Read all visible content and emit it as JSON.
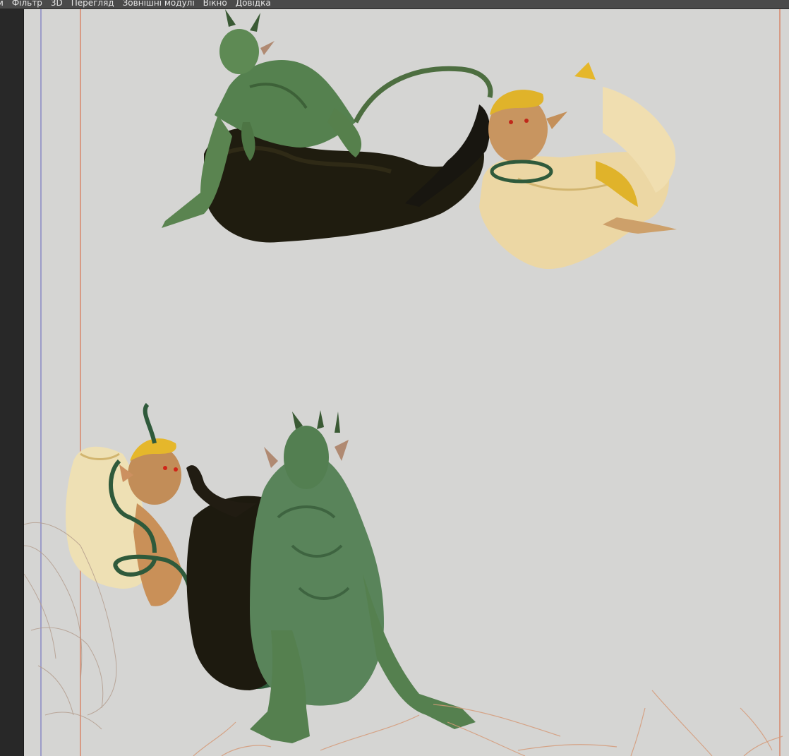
{
  "menubar": {
    "items": [
      {
        "label": "и"
      },
      {
        "label": "Фільтр"
      },
      {
        "label": "3D"
      },
      {
        "label": "Перегляд"
      },
      {
        "label": "Зовнішні модулі"
      },
      {
        "label": "Вікно"
      },
      {
        "label": "Довідка"
      }
    ]
  },
  "canvas": {
    "background": "#d5d5d3",
    "guide_color_blue": "#9c9cc8",
    "guide_color_orange": "#d8866a"
  }
}
